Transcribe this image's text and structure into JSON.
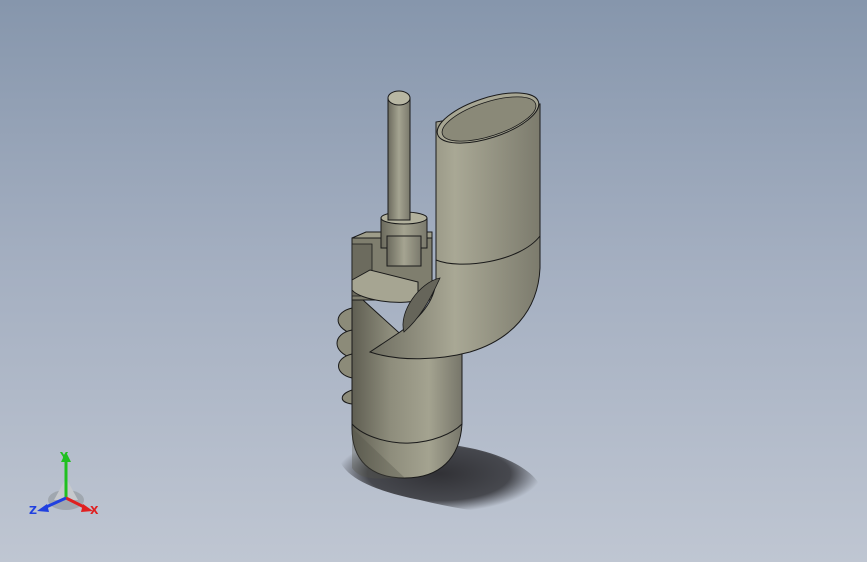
{
  "viewport": {
    "background_top": "#8696ac",
    "background_bottom": "#bfc6d2"
  },
  "model": {
    "body_color": "#8a8978",
    "edge_color": "#1a1a1a",
    "shadow_color": "#2a2a2e"
  },
  "triad": {
    "x_label": "X",
    "y_label": "Y",
    "z_label": "Z",
    "x_color": "#e02020",
    "y_color": "#20c020",
    "z_color": "#2040e0"
  }
}
